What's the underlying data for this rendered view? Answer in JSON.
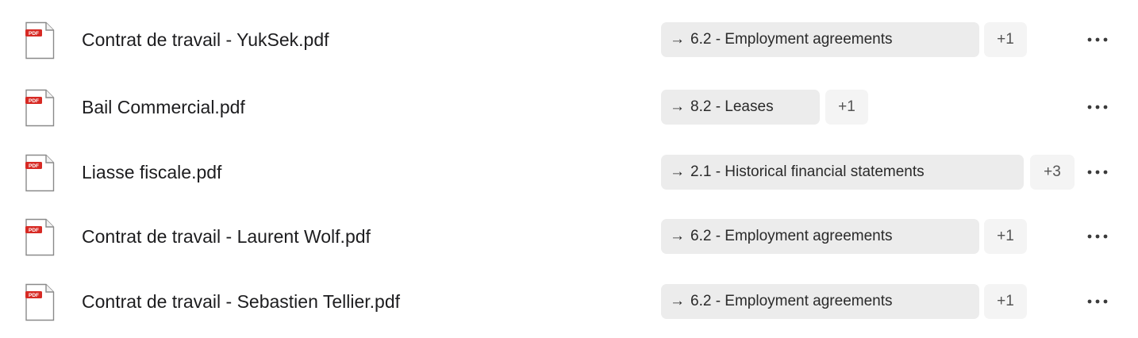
{
  "files": [
    {
      "name": "Contrat de travail - YukSek.pdf",
      "icon": "pdf-file-icon",
      "tag": "6.2 - Employment agreements",
      "extra": "+1",
      "menu_icon": "more-options-icon"
    },
    {
      "name": "Bail Commercial.pdf",
      "icon": "pdf-file-icon",
      "tag": "8.2 - Leases",
      "extra": "+1",
      "menu_icon": "more-options-icon"
    },
    {
      "name": "Liasse fiscale.pdf",
      "icon": "pdf-file-icon",
      "tag": "2.1 - Historical financial statements",
      "extra": "+3",
      "menu_icon": "more-options-icon"
    },
    {
      "name": "Contrat de travail - Laurent Wolf.pdf",
      "icon": "pdf-file-icon",
      "tag": "6.2 - Employment agreements",
      "extra": "+1",
      "menu_icon": "more-options-icon"
    },
    {
      "name": "Contrat de travail - Sebastien Tellier.pdf",
      "icon": "pdf-file-icon",
      "tag": "6.2 - Employment agreements",
      "extra": "+1",
      "menu_icon": "more-options-icon"
    }
  ],
  "tag_arrow": "→",
  "pdf_label": "PDF",
  "colors": {
    "tag_bg": "#ececec",
    "extra_bg": "#f4f4f4",
    "pdf_red": "#d72a24"
  }
}
